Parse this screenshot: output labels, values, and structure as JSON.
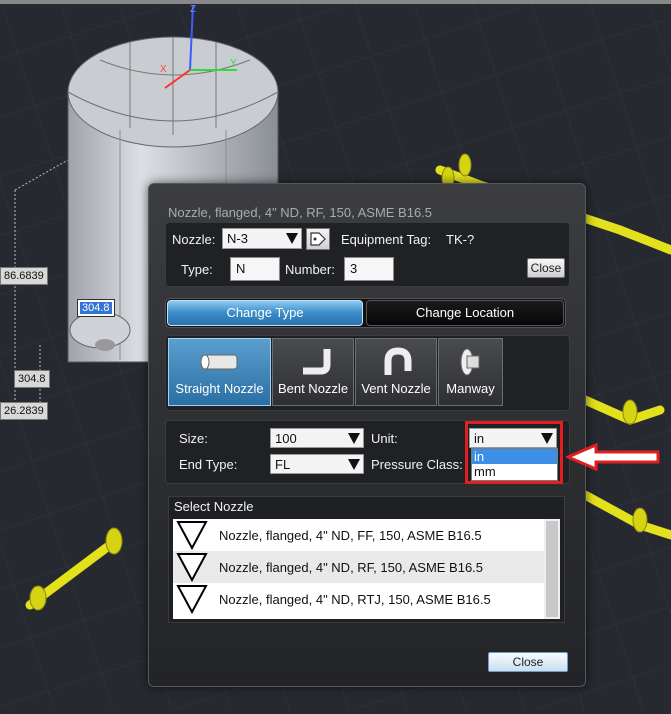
{
  "viewport": {
    "dim_labels": [
      "86.6839",
      "304.8",
      "304.8",
      "26.2839"
    ]
  },
  "dialog": {
    "title": "Nozzle, flanged, 4\" ND, RF, 150, ASME B16.5",
    "nozzle_label": "Nozzle:",
    "nozzle_value": "N-3",
    "equipment_tag_label": "Equipment Tag:",
    "equipment_tag_value": "TK-?",
    "type_label": "Type:",
    "type_value": "N",
    "number_label": "Number:",
    "number_value": "3",
    "close_small_label": "Close",
    "tabs": [
      {
        "label": "Change Type",
        "active": true
      },
      {
        "label": "Change Location",
        "active": false
      }
    ],
    "nozzle_types": [
      {
        "label": "Straight Nozzle",
        "icon": "straight-nozzle-icon",
        "selected": true
      },
      {
        "label": "Bent Nozzle",
        "icon": "bent-nozzle-icon",
        "selected": false
      },
      {
        "label": "Vent Nozzle",
        "icon": "vent-nozzle-icon",
        "selected": false
      },
      {
        "label": "Manway",
        "icon": "manway-icon",
        "selected": false
      }
    ],
    "size_label": "Size:",
    "size_value": "100",
    "unit_label": "Unit:",
    "unit_value": "in",
    "unit_options": [
      "in",
      "mm"
    ],
    "end_type_label": "End Type:",
    "end_type_value": "FL",
    "pressure_class_label": "Pressure Class:",
    "select_nozzle_label": "Select Nozzle",
    "nozzle_list": [
      "Nozzle, flanged, 4\" ND, FF, 150, ASME B16.5",
      "Nozzle, flanged, 4\" ND, RF, 150, ASME B16.5",
      "Nozzle, flanged, 4\" ND, RTJ, 150, ASME B16.5"
    ],
    "close_label": "Close"
  },
  "colors": {
    "accent_blue": "#3a8cc9",
    "highlight_red": "#e02020",
    "pipe_yellow": "#e3e01c"
  }
}
